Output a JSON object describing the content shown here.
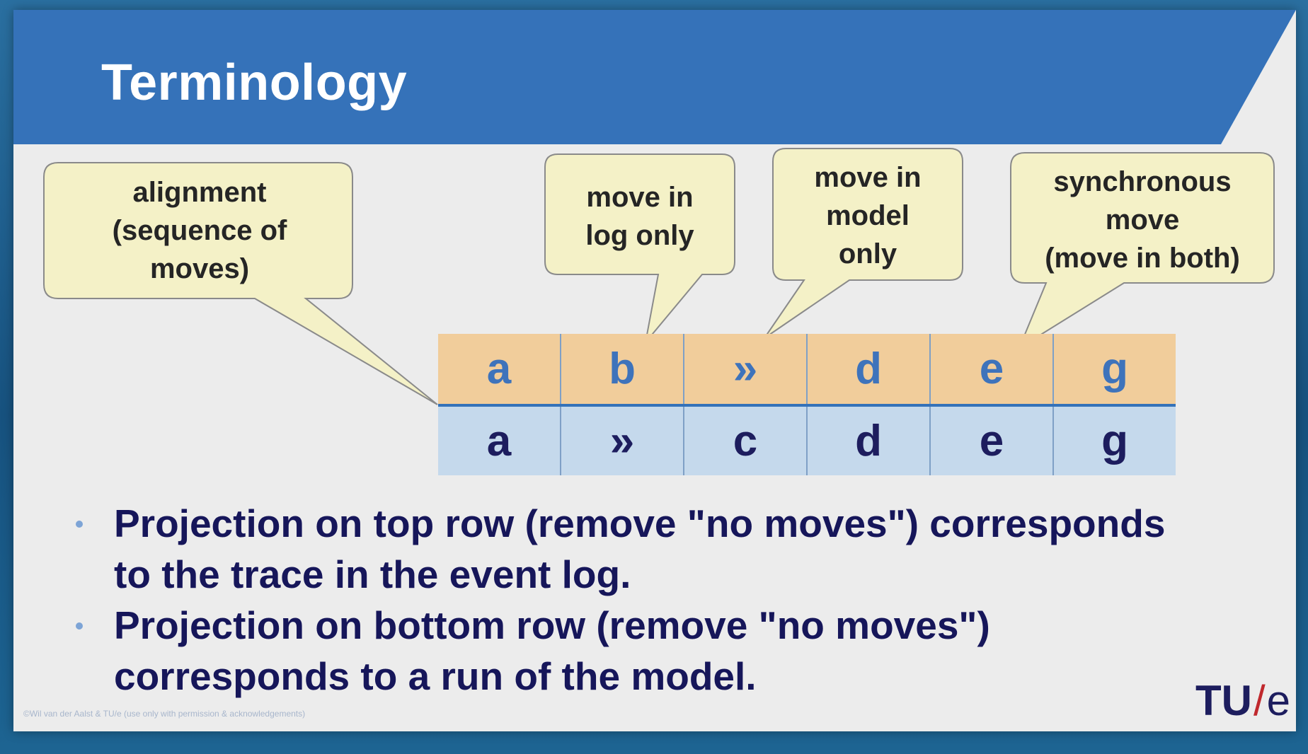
{
  "slide": {
    "title": "Terminology"
  },
  "callouts": {
    "alignment": [
      "alignment",
      "(sequence of",
      "moves)"
    ],
    "log_only": [
      "move in",
      "log only"
    ],
    "model_only": [
      "move in",
      "model",
      "only"
    ],
    "synchronous": [
      "synchronous",
      "move",
      "(move in both)"
    ]
  },
  "alignment_table": {
    "top_row": [
      "a",
      "b",
      "»",
      "d",
      "e",
      "g"
    ],
    "bottom_row": [
      "a",
      "»",
      "c",
      "d",
      "e",
      "g"
    ]
  },
  "bullets": [
    {
      "line1": "Projection on top row (remove \"no moves\") corresponds",
      "line2": "to the trace in the event log."
    },
    {
      "line1": "Projection on bottom row (remove \"no moves\")",
      "line2": "corresponds to a run of the model."
    }
  ],
  "footer": {
    "copyright": "©Wil van der Aalst & TU/e (use only with permission & acknowledgements)"
  },
  "logo": {
    "left": "TU",
    "slash": "/",
    "right": "e"
  },
  "colors": {
    "title_bar": "#3572b9",
    "callout_fill": "#f4f1c7",
    "table_top": "#f1cd9b",
    "table_bottom": "#c5d9ec"
  }
}
